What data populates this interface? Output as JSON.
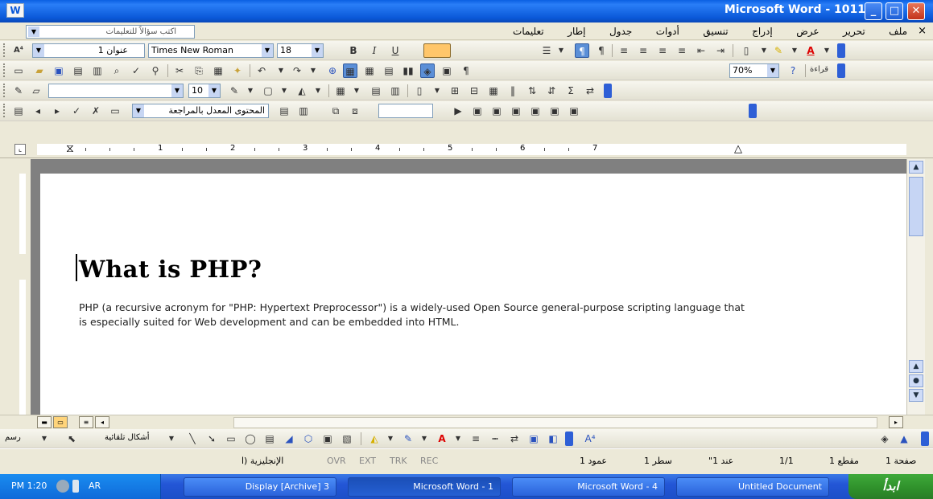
{
  "window": {
    "title": "Microsoft Word - 1011",
    "buttons": {
      "minimize": "_",
      "maximize": "□",
      "close": "✕"
    }
  },
  "menubar": {
    "ask_placeholder": "اكتب سؤالاً للتعليمات",
    "items": [
      "ملف",
      "تحرير",
      "عرض",
      "إدراج",
      "تنسيق",
      "أدوات",
      "جدول",
      "إطار",
      "تعليمات"
    ],
    "close_label": "×"
  },
  "formatting": {
    "style": "عنوان 1",
    "font": "Times New Roman",
    "size": "18",
    "bold": "B",
    "italic": "I",
    "underline": "U"
  },
  "standard": {
    "zoom": "70%",
    "read_label": "قراءة"
  },
  "tables_toolbar": {
    "size": "10"
  },
  "reviewing": {
    "markup_label": "المحتوى المعدل بالمراجعة"
  },
  "ruler": {
    "numbers": [
      "1",
      "2",
      "3",
      "4",
      "5",
      "6",
      "7"
    ]
  },
  "document": {
    "heading": "What is PHP?",
    "paragraph": "PHP (a recursive acronym for \"PHP: Hypertext Preprocessor\") is a widely-used Open Source general-purpose scripting language that is especially suited for Web development and can be embedded into HTML."
  },
  "drawing_toolbar": {
    "draw_label": "رسم",
    "autoshapes_label": "أشكال تلقائية"
  },
  "statusbar": {
    "page": "صفحة 1",
    "section": "مقطع 1",
    "page_of": "1/1",
    "position": "عند 1\"",
    "line": "سطر 1",
    "column": "عمود 1",
    "rec": "REC",
    "trk": "TRK",
    "ext": "EXT",
    "ovr": "OVR",
    "language": "الإنجليزية (ا"
  },
  "taskbar": {
    "start_label": "ابدأ",
    "time": "PM 1:20",
    "lang": "AR",
    "tasks": [
      "Untitled Document",
      "4 - Microsoft Word",
      "Microsoft Word - 1",
      "3 Display [Archive]"
    ]
  }
}
